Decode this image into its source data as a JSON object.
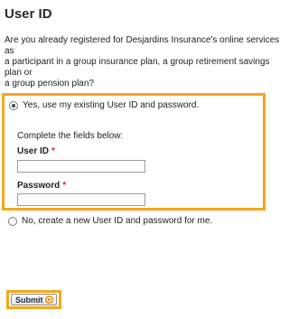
{
  "header": {
    "title": "User ID"
  },
  "intro": {
    "lines": [
      "Are you already registered for Desjardins Insurance's online services",
      "as",
      "a participant in a group insurance plan, a group retirement savings",
      "plan or",
      "a group pension plan?"
    ]
  },
  "existing_option": {
    "label": "Yes, use my existing User ID and password.",
    "selected": true,
    "instructions": "Complete the fields below:",
    "user_id": {
      "label": "User ID",
      "required_mark": "*",
      "value": ""
    },
    "password": {
      "label": "Password",
      "required_mark": "*",
      "value": ""
    }
  },
  "new_option": {
    "label": "No, create a new User ID and password for me.",
    "selected": false
  },
  "submit": {
    "label": "Submit"
  },
  "colors": {
    "focus_outline": "#f2a81d",
    "required_mark": "#d62828",
    "submit_icon": "#f28c0f"
  },
  "icons": {
    "submit": "arrow-right-circle-icon"
  }
}
